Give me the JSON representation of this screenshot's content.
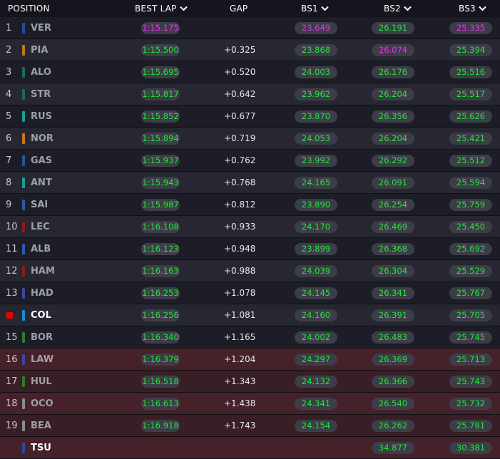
{
  "columns": {
    "position": "POSITION",
    "best_lap": "BEST LAP",
    "gap": "GAP",
    "bs1": "BS1",
    "bs2": "BS2",
    "bs3": "BS3"
  },
  "colors": {
    "personal_best": "#24e43c",
    "overall_best": "#e830e8",
    "eliminated_row": "#3a1e25",
    "current_marker": "#e10600"
  },
  "rows": [
    {
      "pos": "1",
      "driver": "VER",
      "team_color": "#2a4aa0",
      "best_lap": "1:15.175",
      "best_color": "purple",
      "gap": "",
      "bs1": "23.649",
      "bs1_color": "purple",
      "bs2": "26.191",
      "bs2_color": "green",
      "bs3": "25.335",
      "bs3_color": "purple",
      "eliminated": false,
      "highlight": false
    },
    {
      "pos": "2",
      "driver": "PIA",
      "team_color": "#c8761e",
      "best_lap": "1:15.500",
      "best_color": "green",
      "gap": "+0.325",
      "bs1": "23.868",
      "bs1_color": "green",
      "bs2": "26.074",
      "bs2_color": "purple",
      "bs3": "25.394",
      "bs3_color": "green",
      "eliminated": false,
      "highlight": false
    },
    {
      "pos": "3",
      "driver": "ALO",
      "team_color": "#1d6a50",
      "best_lap": "1:15.695",
      "best_color": "green",
      "gap": "+0.520",
      "bs1": "24.003",
      "bs1_color": "green",
      "bs2": "26.176",
      "bs2_color": "green",
      "bs3": "25.516",
      "bs3_color": "green",
      "eliminated": false,
      "highlight": false
    },
    {
      "pos": "4",
      "driver": "STR",
      "team_color": "#1d6a50",
      "best_lap": "1:15.817",
      "best_color": "green",
      "gap": "+0.642",
      "bs1": "23.962",
      "bs1_color": "green",
      "bs2": "26.204",
      "bs2_color": "green",
      "bs3": "25.517",
      "bs3_color": "green",
      "eliminated": false,
      "highlight": false
    },
    {
      "pos": "5",
      "driver": "RUS",
      "team_color": "#1f9e8e",
      "best_lap": "1:15.852",
      "best_color": "green",
      "gap": "+0.677",
      "bs1": "23.870",
      "bs1_color": "green",
      "bs2": "26.356",
      "bs2_color": "green",
      "bs3": "25.626",
      "bs3_color": "green",
      "eliminated": false,
      "highlight": false
    },
    {
      "pos": "6",
      "driver": "NOR",
      "team_color": "#c8761e",
      "best_lap": "1:15.894",
      "best_color": "green",
      "gap": "+0.719",
      "bs1": "24.053",
      "bs1_color": "green",
      "bs2": "26.204",
      "bs2_color": "green",
      "bs3": "25.421",
      "bs3_color": "green",
      "eliminated": false,
      "highlight": false
    },
    {
      "pos": "7",
      "driver": "GAS",
      "team_color": "#1e5a9a",
      "best_lap": "1:15.937",
      "best_color": "green",
      "gap": "+0.762",
      "bs1": "23.992",
      "bs1_color": "green",
      "bs2": "26.292",
      "bs2_color": "green",
      "bs3": "25.512",
      "bs3_color": "green",
      "eliminated": false,
      "highlight": false
    },
    {
      "pos": "8",
      "driver": "ANT",
      "team_color": "#1f9e8e",
      "best_lap": "1:15.943",
      "best_color": "green",
      "gap": "+0.768",
      "bs1": "24.165",
      "bs1_color": "green",
      "bs2": "26.091",
      "bs2_color": "green",
      "bs3": "25.594",
      "bs3_color": "green",
      "eliminated": false,
      "highlight": false
    },
    {
      "pos": "9",
      "driver": "SAI",
      "team_color": "#2d5aa8",
      "best_lap": "1:15.987",
      "best_color": "green",
      "gap": "+0.812",
      "bs1": "23.890",
      "bs1_color": "green",
      "bs2": "26.254",
      "bs2_color": "green",
      "bs3": "25.759",
      "bs3_color": "green",
      "eliminated": false,
      "highlight": false
    },
    {
      "pos": "10",
      "driver": "LEC",
      "team_color": "#8a1a24",
      "best_lap": "1:16.108",
      "best_color": "green",
      "gap": "+0.933",
      "bs1": "24.170",
      "bs1_color": "green",
      "bs2": "26.469",
      "bs2_color": "green",
      "bs3": "25.450",
      "bs3_color": "green",
      "eliminated": false,
      "highlight": false
    },
    {
      "pos": "11",
      "driver": "ALB",
      "team_color": "#2d5aa8",
      "best_lap": "1:16.123",
      "best_color": "green",
      "gap": "+0.948",
      "bs1": "23.899",
      "bs1_color": "green",
      "bs2": "26.368",
      "bs2_color": "green",
      "bs3": "25.692",
      "bs3_color": "green",
      "eliminated": false,
      "highlight": false
    },
    {
      "pos": "12",
      "driver": "HAM",
      "team_color": "#8a1a24",
      "best_lap": "1:16.163",
      "best_color": "green",
      "gap": "+0.988",
      "bs1": "24.039",
      "bs1_color": "green",
      "bs2": "26.304",
      "bs2_color": "green",
      "bs3": "25.529",
      "bs3_color": "green",
      "eliminated": false,
      "highlight": false
    },
    {
      "pos": "13",
      "driver": "HAD",
      "team_color": "#3a4a9a",
      "best_lap": "1:16.253",
      "best_color": "green",
      "gap": "+1.078",
      "bs1": "24.145",
      "bs1_color": "green",
      "bs2": "26.341",
      "bs2_color": "green",
      "bs3": "25.767",
      "bs3_color": "green",
      "eliminated": false,
      "highlight": false
    },
    {
      "pos": "",
      "driver": "COL",
      "team_color": "#1a8ad4",
      "best_lap": "1:16.256",
      "best_color": "green",
      "gap": "+1.081",
      "bs1": "24.160",
      "bs1_color": "green",
      "bs2": "26.391",
      "bs2_color": "green",
      "bs3": "25.705",
      "bs3_color": "green",
      "eliminated": false,
      "highlight": true
    },
    {
      "pos": "15",
      "driver": "BOR",
      "team_color": "#2e7a2e",
      "best_lap": "1:16.340",
      "best_color": "green",
      "gap": "+1.165",
      "bs1": "24.002",
      "bs1_color": "green",
      "bs2": "26.483",
      "bs2_color": "green",
      "bs3": "25.745",
      "bs3_color": "green",
      "eliminated": false,
      "highlight": false
    },
    {
      "pos": "16",
      "driver": "LAW",
      "team_color": "#3a4a9a",
      "best_lap": "1:16.379",
      "best_color": "green",
      "gap": "+1.204",
      "bs1": "24.297",
      "bs1_color": "green",
      "bs2": "26.369",
      "bs2_color": "green",
      "bs3": "25.713",
      "bs3_color": "green",
      "eliminated": true,
      "highlight": false
    },
    {
      "pos": "17",
      "driver": "HUL",
      "team_color": "#2e7a2e",
      "best_lap": "1:16.518",
      "best_color": "green",
      "gap": "+1.343",
      "bs1": "24.132",
      "bs1_color": "green",
      "bs2": "26.366",
      "bs2_color": "green",
      "bs3": "25.743",
      "bs3_color": "green",
      "eliminated": true,
      "highlight": false
    },
    {
      "pos": "18",
      "driver": "OCO",
      "team_color": "#8a8a90",
      "best_lap": "1:16.613",
      "best_color": "green",
      "gap": "+1.438",
      "bs1": "24.341",
      "bs1_color": "green",
      "bs2": "26.540",
      "bs2_color": "green",
      "bs3": "25.732",
      "bs3_color": "green",
      "eliminated": true,
      "highlight": false
    },
    {
      "pos": "19",
      "driver": "BEA",
      "team_color": "#8a8a90",
      "best_lap": "1:16.918",
      "best_color": "green",
      "gap": "+1.743",
      "bs1": "24.154",
      "bs1_color": "green",
      "bs2": "26.262",
      "bs2_color": "green",
      "bs3": "25.781",
      "bs3_color": "green",
      "eliminated": true,
      "highlight": false
    },
    {
      "pos": "",
      "driver": "TSU",
      "team_color": "#2a4aa0",
      "best_lap": "",
      "best_color": "green",
      "gap": "",
      "bs1": "",
      "bs1_color": "green",
      "bs2": "34.877",
      "bs2_color": "green",
      "bs3": "30.381",
      "bs3_color": "green",
      "eliminated": true,
      "highlight": true
    }
  ]
}
